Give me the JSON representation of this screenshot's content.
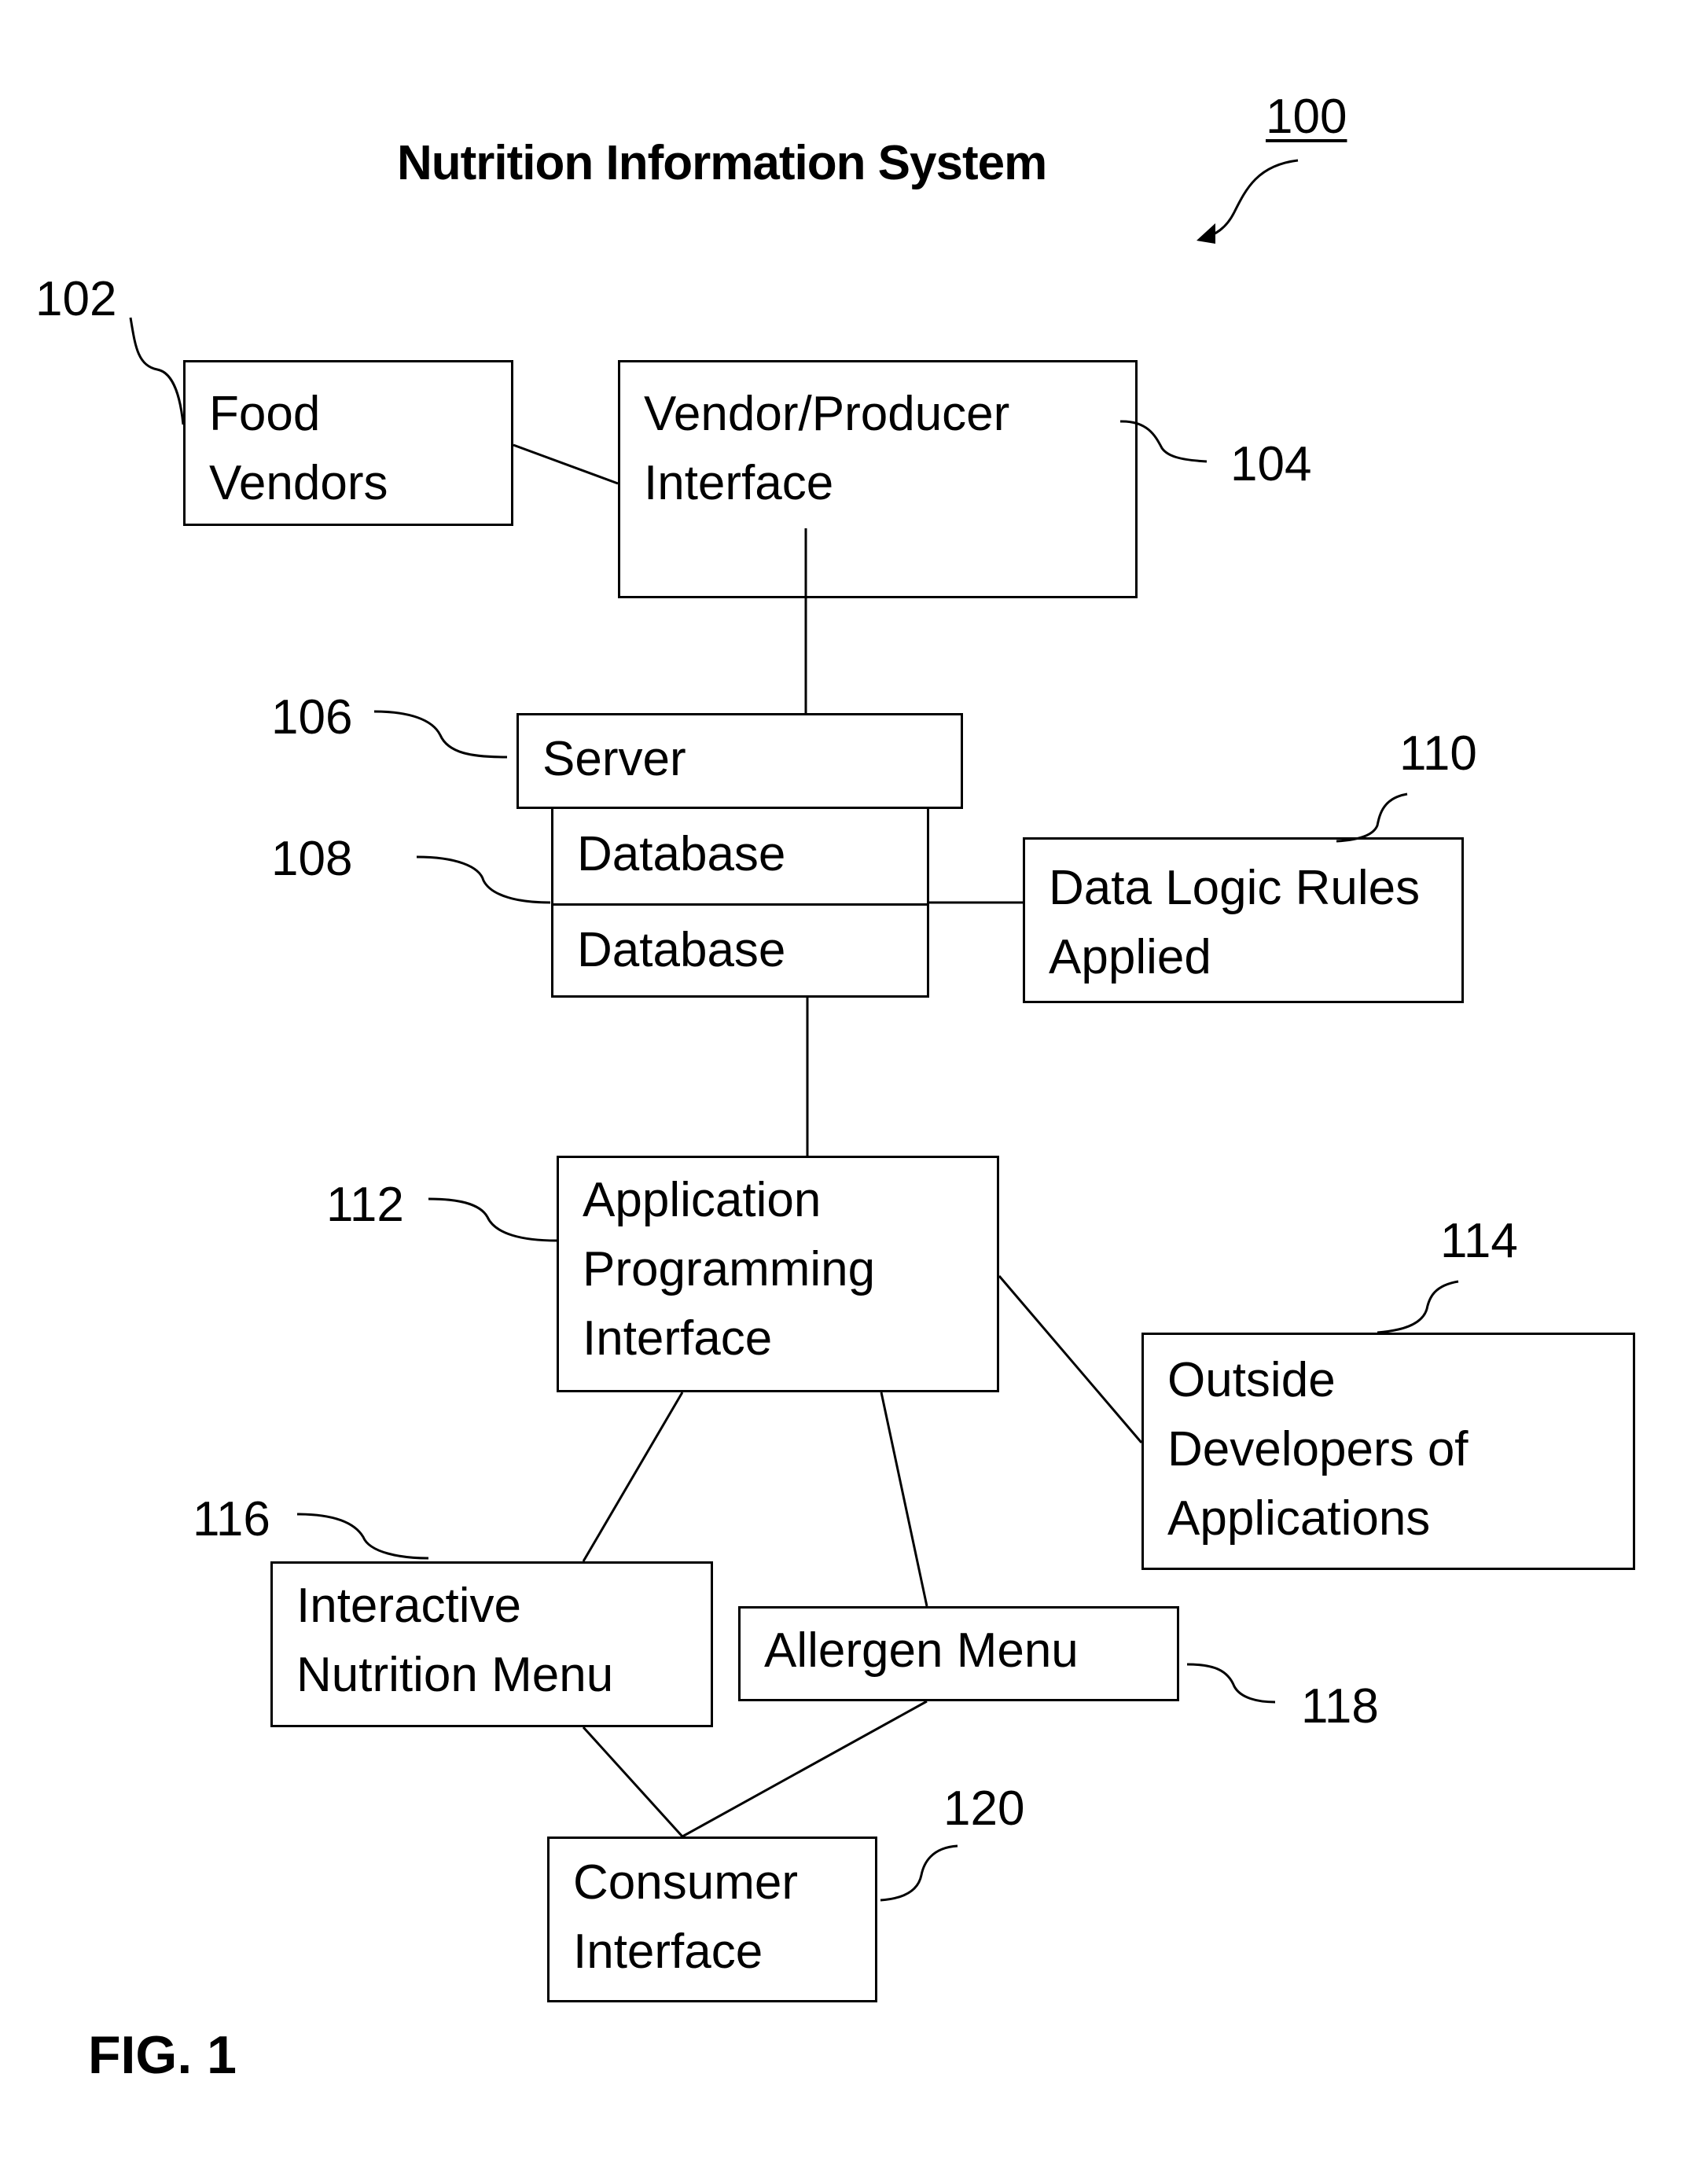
{
  "title": "Nutrition Information System",
  "figure_label": "FIG. 1",
  "system_ref": "100",
  "nodes": {
    "food_vendors": {
      "ref": "102",
      "lines": [
        "Food",
        "Vendors"
      ]
    },
    "vendor_producer_interface": {
      "ref": "104",
      "lines": [
        "Vendor/Producer",
        "Interface"
      ]
    },
    "server": {
      "ref": "106",
      "label": "Server"
    },
    "database": {
      "ref": "108",
      "labels": [
        "Database",
        "Database"
      ]
    },
    "data_logic_rules": {
      "ref": "110",
      "lines": [
        "Data Logic Rules",
        "Applied"
      ]
    },
    "api": {
      "ref": "112",
      "lines": [
        "Application",
        "Programming",
        "Interface"
      ]
    },
    "outside_developers": {
      "ref": "114",
      "lines": [
        "Outside",
        "Developers of",
        "Applications"
      ]
    },
    "interactive_nutrition_menu": {
      "ref": "116",
      "lines": [
        "Interactive",
        "Nutrition Menu"
      ]
    },
    "allergen_menu": {
      "ref": "118",
      "label": "Allergen Menu"
    },
    "consumer_interface": {
      "ref": "120",
      "lines": [
        "Consumer",
        "Interface"
      ]
    }
  },
  "edges": [
    [
      "food_vendors",
      "vendor_producer_interface"
    ],
    [
      "vendor_producer_interface",
      "server"
    ],
    [
      "database",
      "data_logic_rules"
    ],
    [
      "database",
      "api"
    ],
    [
      "api",
      "outside_developers"
    ],
    [
      "api",
      "interactive_nutrition_menu"
    ],
    [
      "api",
      "allergen_menu"
    ],
    [
      "interactive_nutrition_menu",
      "consumer_interface"
    ],
    [
      "allergen_menu",
      "consumer_interface"
    ]
  ]
}
